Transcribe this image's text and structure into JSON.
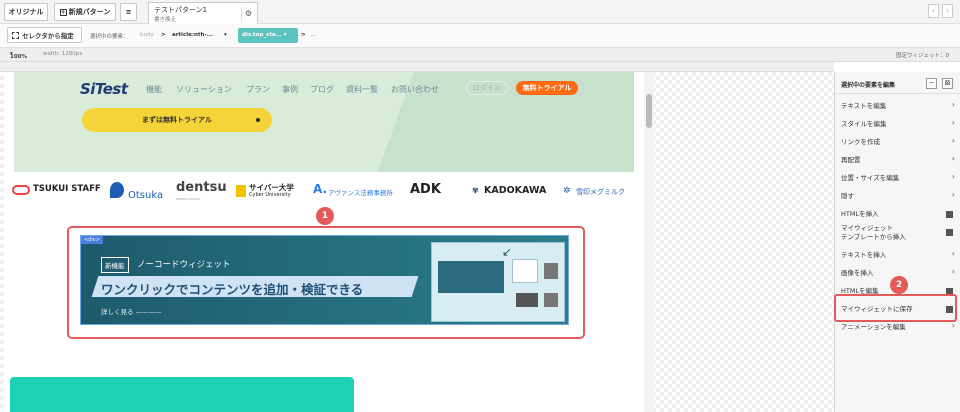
{
  "toolbar": {
    "original_label": "オリジナル",
    "new_pattern_label": "新規パターン",
    "list_icon": "list-icon",
    "tab_title": "テストパターン1",
    "tab_subtitle": "書き換え",
    "gear_icon": "gear-icon",
    "prev": "‹",
    "next": "›"
  },
  "selector_bar": {
    "select_button_label": "セレクタから指定",
    "selected_label": "選択中の要素：",
    "crumb_body": "body",
    "crumb_article": "article:nth-...",
    "crumb_active": "div.top_cta...",
    "crumb_more": "...",
    "sep": ">"
  },
  "zoom_bar": {
    "zoom": "100%",
    "width": "width: 1280px",
    "fixed_widgets": "固定ウィジェット：0"
  },
  "hero": {
    "logo": "SiTest",
    "nav": [
      "機能",
      "ソリューション",
      "プラン",
      "事例",
      "ブログ",
      "資料一覧",
      "お問い合わせ"
    ],
    "login": "ログイン",
    "trial": "無料トライアル",
    "cta": "まずは無料トライアル"
  },
  "logos": [
    "TSUKUI STAFF",
    "Otsuka",
    "dentsu",
    "サイバー大学",
    "アヴァンス法務事務所",
    "ADK",
    "KADOKAWA",
    "雪印メグミルク"
  ],
  "logos_sub": {
    "cyber": "Cyber University",
    "dentsu": "DENTSU DIGITAL"
  },
  "banner": {
    "div_tag": "<div>",
    "new_tag": "新機能",
    "subtitle": "ノーコードウィジェット",
    "headline": "ワンクリックでコンテンツを追加・検証できる",
    "more": "詳しく見る ————"
  },
  "badges": {
    "one": "1",
    "two": "2"
  },
  "panel": {
    "title": "選択中の要素を編集",
    "minimize": "−",
    "close": "⊠",
    "items": [
      {
        "label": "テキストを編集",
        "icon": "chevron-right-icon"
      },
      {
        "label": "スタイルを編集",
        "icon": "chevron-right-icon"
      },
      {
        "label": "リンクを作成",
        "icon": "chevron-right-icon"
      },
      {
        "label": "再配置",
        "icon": "chevron-right-icon"
      },
      {
        "label": "位置・サイズを編集",
        "icon": "chevron-right-icon"
      },
      {
        "label": "隠す",
        "icon": "chevron-right-icon"
      },
      {
        "label": "HTMLを挿入",
        "icon": "copy-icon"
      },
      {
        "label": "マイウィジェット",
        "label2": "テンプレートから挿入",
        "icon": "copy-icon"
      },
      {
        "label": "テキストを挿入",
        "icon": "chevron-right-icon"
      },
      {
        "label": "画像を挿入",
        "icon": "chevron-right-icon"
      },
      {
        "label": "HTMLを編集",
        "icon": "copy-icon"
      },
      {
        "label": "マイウィジェットに保存",
        "icon": "copy-icon"
      },
      {
        "label": "アニメーションを編集",
        "icon": "chevron-right-icon"
      }
    ]
  },
  "colors": {
    "highlight_red": "#e45a5a",
    "teal": "#5bc4c1",
    "trial_orange": "#ff6a13",
    "cta_yellow": "#f5d43a"
  }
}
